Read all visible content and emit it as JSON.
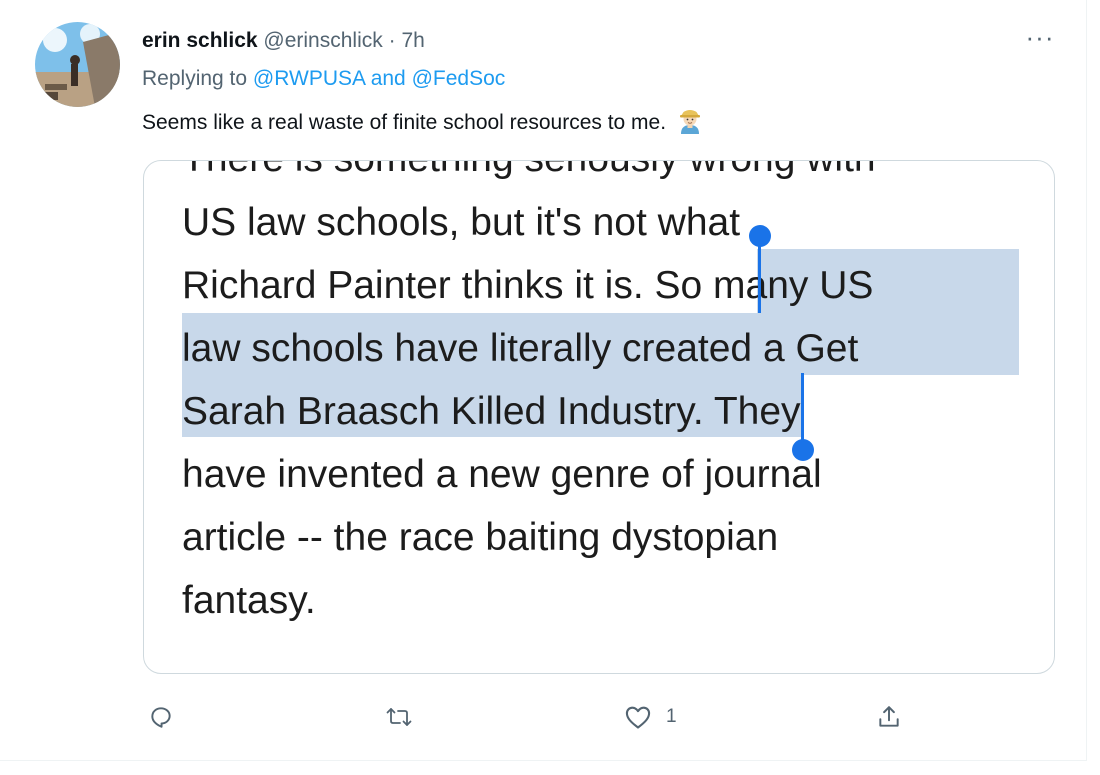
{
  "tweet": {
    "display_name": "erin schlick",
    "handle": "@erinschlick",
    "separator": "·",
    "time": "7h",
    "more_label": "···",
    "replying_prefix": "Replying to",
    "reply_user_1": "@RWPUSA",
    "reply_joiner": "and",
    "reply_user_2": "@FedSoc",
    "text": "Seems like a real waste of finite school resources to me.",
    "emoji": "man-farmer-emoji"
  },
  "quote_image": {
    "cut_line": "There is something seriously wrong with",
    "line_1": "US law schools, but it's not what",
    "line_2a": "Richard Painter thinks it is. ",
    "line_2b": "So many US",
    "line_3": "law schools have literally created a Get",
    "line_4a": "Sarah Braasch Killed Industry.",
    "line_4b": " They",
    "line_5": "have invented a new genre of journal",
    "line_6": "article -- the race baiting dystopian",
    "line_7": "fantasy."
  },
  "actions": {
    "reply_icon": "reply-icon",
    "retweet_icon": "retweet-icon",
    "like_icon": "like-icon",
    "like_count": "1",
    "share_icon": "share-icon"
  },
  "colors": {
    "link": "#1d9bf0",
    "secondary_text": "#536471",
    "selection_highlight": "#c8d8ea",
    "selection_handle": "#1a73e8"
  }
}
